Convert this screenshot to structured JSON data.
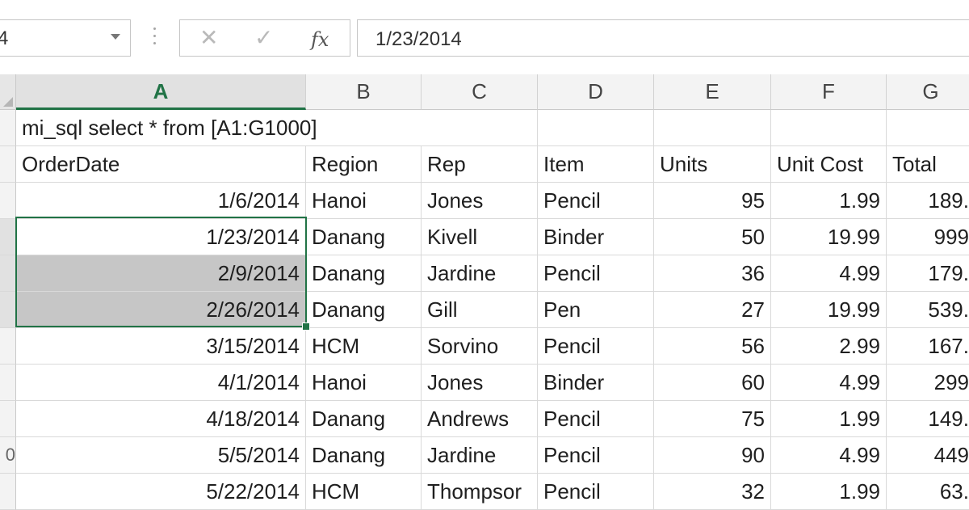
{
  "name_box": {
    "value": "4"
  },
  "formula_bar": {
    "cancel_glyph": "✕",
    "enter_glyph": "✓",
    "fx_label": "fx",
    "value": "1/23/2014"
  },
  "grid": {
    "columns": [
      "A",
      "B",
      "C",
      "D",
      "E",
      "F",
      "G"
    ],
    "selected_column": "A",
    "row_labels": [
      "",
      "",
      "",
      "",
      "",
      "",
      "",
      "",
      "",
      "0",
      ""
    ],
    "title_row": "mi_sql select * from [A1:G1000]",
    "headers": [
      "OrderDate",
      "Region",
      "Rep",
      "Item",
      "Units",
      "Unit Cost",
      "Total"
    ],
    "rows": [
      [
        "1/6/2014",
        "Hanoi",
        "Jones",
        "Pencil",
        "95",
        "1.99",
        "189."
      ],
      [
        "1/23/2014",
        "Danang",
        "Kivell",
        "Binder",
        "50",
        "19.99",
        "999"
      ],
      [
        "2/9/2014",
        "Danang",
        "Jardine",
        "Pencil",
        "36",
        "4.99",
        "179."
      ],
      [
        "2/26/2014",
        "Danang",
        "Gill",
        "Pen",
        "27",
        "19.99",
        "539."
      ],
      [
        "3/15/2014",
        "HCM",
        "Sorvino",
        "Pencil",
        "56",
        "2.99",
        "167."
      ],
      [
        "4/1/2014",
        "Hanoi",
        "Jones",
        "Binder",
        "60",
        "4.99",
        "299"
      ],
      [
        "4/18/2014",
        "Danang",
        "Andrews",
        "Pencil",
        "75",
        "1.99",
        "149."
      ],
      [
        "5/5/2014",
        "Danang",
        "Jardine",
        "Pencil",
        "90",
        "4.99",
        "449"
      ],
      [
        "5/22/2014",
        "HCM",
        "Thompsor",
        "Pencil",
        "32",
        "1.99",
        "63."
      ]
    ]
  },
  "colors": {
    "accent": "#217346",
    "selection_fill": "#c6c6c6"
  }
}
